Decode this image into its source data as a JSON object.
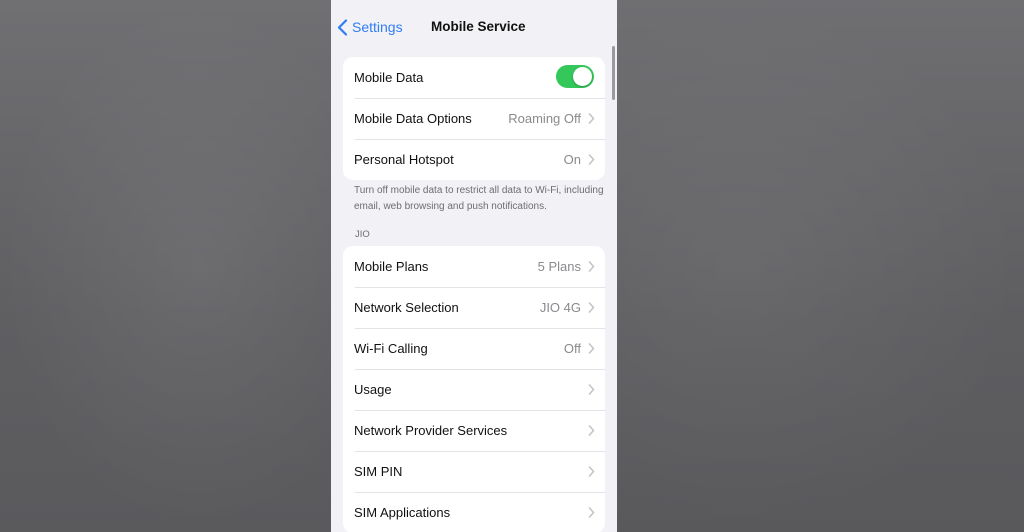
{
  "navbar": {
    "back_label": "Settings",
    "title": "Mobile Service"
  },
  "group1": {
    "mobile_data": {
      "label": "Mobile Data",
      "toggle_on": true
    },
    "mobile_data_options": {
      "label": "Mobile Data Options",
      "value": "Roaming Off"
    },
    "personal_hotspot": {
      "label": "Personal Hotspot",
      "value": "On"
    }
  },
  "footnote": "Turn off mobile data to restrict all data to Wi-Fi, including email, web browsing and push notifications.",
  "section_header": "JIO",
  "group2": {
    "items": [
      {
        "label": "Mobile Plans",
        "value": "5 Plans"
      },
      {
        "label": "Network Selection",
        "value": "JIO 4G"
      },
      {
        "label": "Wi-Fi Calling",
        "value": "Off"
      },
      {
        "label": "Usage",
        "value": ""
      },
      {
        "label": "Network Provider Services",
        "value": ""
      },
      {
        "label": "SIM PIN",
        "value": ""
      },
      {
        "label": "SIM Applications",
        "value": ""
      }
    ]
  },
  "colors": {
    "accent": "#2f7cf6",
    "toggle_on": "#34c759",
    "background": "#f2f2f6"
  }
}
